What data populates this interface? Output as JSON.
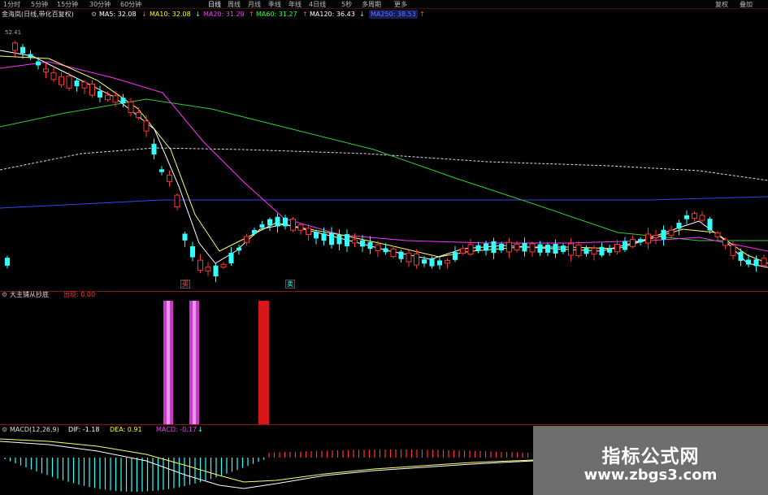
{
  "toolbar": {
    "periods": [
      "1分时",
      "5分钟",
      "15分钟",
      "30分钟",
      "60分钟",
      "日线",
      "周线",
      "月线",
      "季线",
      "年线",
      "4日线",
      "5秒",
      "多周期",
      "更多"
    ],
    "active_period": "日线",
    "right_buttons": [
      "复权",
      "叠加"
    ]
  },
  "main_legend": {
    "stock_name": "金海岚(日线,带化百复权)",
    "items": [
      {
        "label": "MA5: 32.08",
        "arrow": "↓",
        "color": "#ffffff"
      },
      {
        "label": "MA10: 32.08",
        "arrow": "↓",
        "color": "#ffff00"
      },
      {
        "label": "MA20: 31.29",
        "arrow": "↑",
        "color": "#ff33ff"
      },
      {
        "label": "MA60: 31.27",
        "arrow": "↑",
        "color": "#33ff33"
      },
      {
        "label": "MA120: 36.43",
        "arrow": "↓",
        "color": "#ffffff"
      },
      {
        "label": "MA250: 38.53",
        "arrow": "↑",
        "color": "#4d6bff"
      }
    ]
  },
  "price_label": "52.41",
  "signals": {
    "buy_label": "买",
    "sell_label": "卖"
  },
  "sub_indicator": {
    "name": "大主铺从抄底",
    "value_label": "出现: 0.00"
  },
  "macd_legend": {
    "name": "MACD(12,26,9)",
    "dif": "DIF: -1.18",
    "dea": "DEA: 0.91",
    "macd": "MACD: -0.17",
    "arrow": "↓"
  },
  "watermark": {
    "title": "指标公式网",
    "url": "www.zbgs3.com"
  },
  "colors": {
    "background": "#000000",
    "up": "#ff3333",
    "down": "#33ffff",
    "ma5": "#ffffff",
    "ma10": "#ffff66",
    "ma20": "#ff33ff",
    "ma60": "#33cc33",
    "ma120": "#dddddd",
    "ma250": "#3344ff",
    "signal_buy": "#dd33dd",
    "signal_sell": "#dd1111",
    "separator": "#8a1515"
  }
}
